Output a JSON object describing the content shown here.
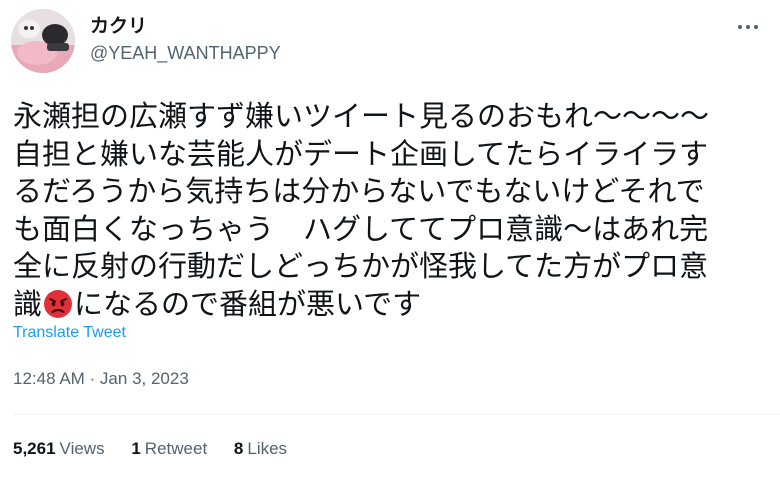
{
  "user": {
    "display_name": "カクリ",
    "handle": "@YEAH_WANTHAPPY"
  },
  "icons": {
    "more": "more-horizontal-icon",
    "emoji": "angry-face-emoji"
  },
  "tweet": {
    "lines": [
      "永瀬担の広瀬すず嫌いツイート見るのおもれ〜〜〜〜",
      "自担と嫌いな芸能人がデート企画してたらイライラす",
      "るだろうから気持ちは分からないでもないけどそれで",
      "も面白くなっちゃう　ハグしててプロ意識〜はあれ完",
      "全に反射の行動だしどっちかが怪我してた方がプロ意",
      "識",
      "になるので番組が悪いです"
    ],
    "translate_label": "Translate Tweet",
    "timestamp": "12:48 AM · Jan 3, 2023"
  },
  "stats": {
    "views_count": "5,261",
    "views_label": "Views",
    "retweets_count": "1",
    "retweets_label": "Retweet",
    "likes_count": "8",
    "likes_label": "Likes"
  },
  "colors": {
    "text": "#0f1419",
    "secondary": "#536471",
    "link": "#1d9bf0",
    "divider": "#eff3f4",
    "emoji_red": "#e0303a"
  }
}
